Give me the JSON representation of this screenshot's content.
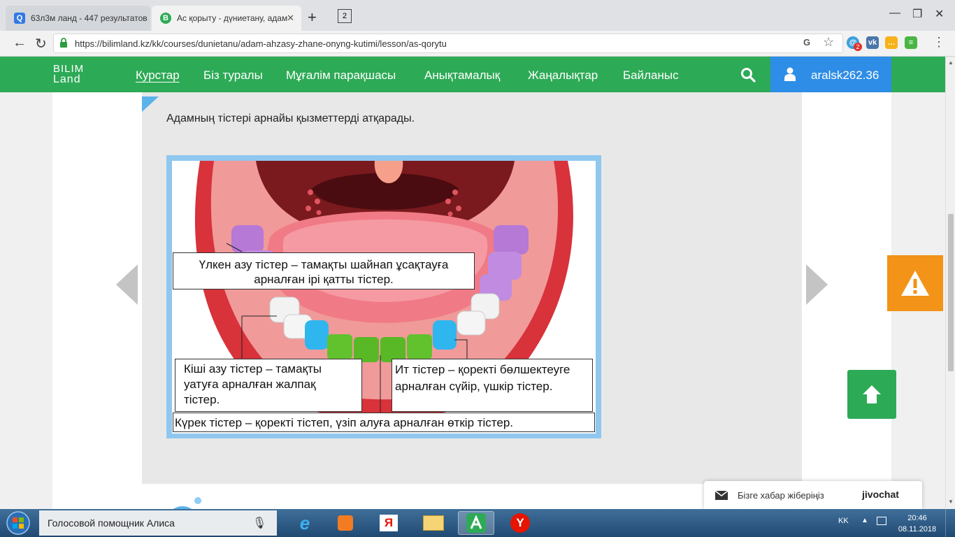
{
  "browser": {
    "tabs": [
      {
        "title": "63л3м ланд - 447 результатов",
        "icon": "search-favicon",
        "active": false
      },
      {
        "title": "Ас қорыту - дүниетану, адам",
        "icon": "bilimland-favicon",
        "active": true
      }
    ],
    "tab_count": "2",
    "url": "https://bilimland.kz/kk/courses/dunietanu/adam-ahzasy-zhane-onyng-kutimi/lesson/as-qorytu",
    "extension_badge": "2"
  },
  "site": {
    "logo_line1": "BILIM",
    "logo_line2": "Land",
    "nav": [
      "Курстар",
      "Біз туралы",
      "Мұғалім парақшасы",
      "Анықтамалық",
      "Жаңалықтар",
      "Байланыс"
    ],
    "username": "aralsk262.36"
  },
  "lesson": {
    "text": "Адамның тістері арнайы қызметтерді атқарады.",
    "figure_labels": {
      "molars": "Үлкен азу тістер – тамақты шайнап ұсақтауға арналған ірі  қатты тістер.",
      "premolars": "Кіші азу тістер – тамақты уатуға арналған жалпақ тістер.",
      "canines": "Ит тістер – қоректі бөлшектеуге арналған сүйір, үшкір тістер.",
      "incisors": "Күрек тістер – қоректі тістеп, үзіп алуға арналған өткір тістер."
    }
  },
  "chat": {
    "text": "Бізге хабар жіберіңіз",
    "brand": "jivochat"
  },
  "taskbar": {
    "assistant": "Голосовой помощник Алиса",
    "lang": "KK",
    "time": "20:46",
    "date": "08.11.2018"
  },
  "colors": {
    "site_green": "#2daa56",
    "user_blue": "#2e8de6",
    "warning_orange": "#f39318"
  }
}
